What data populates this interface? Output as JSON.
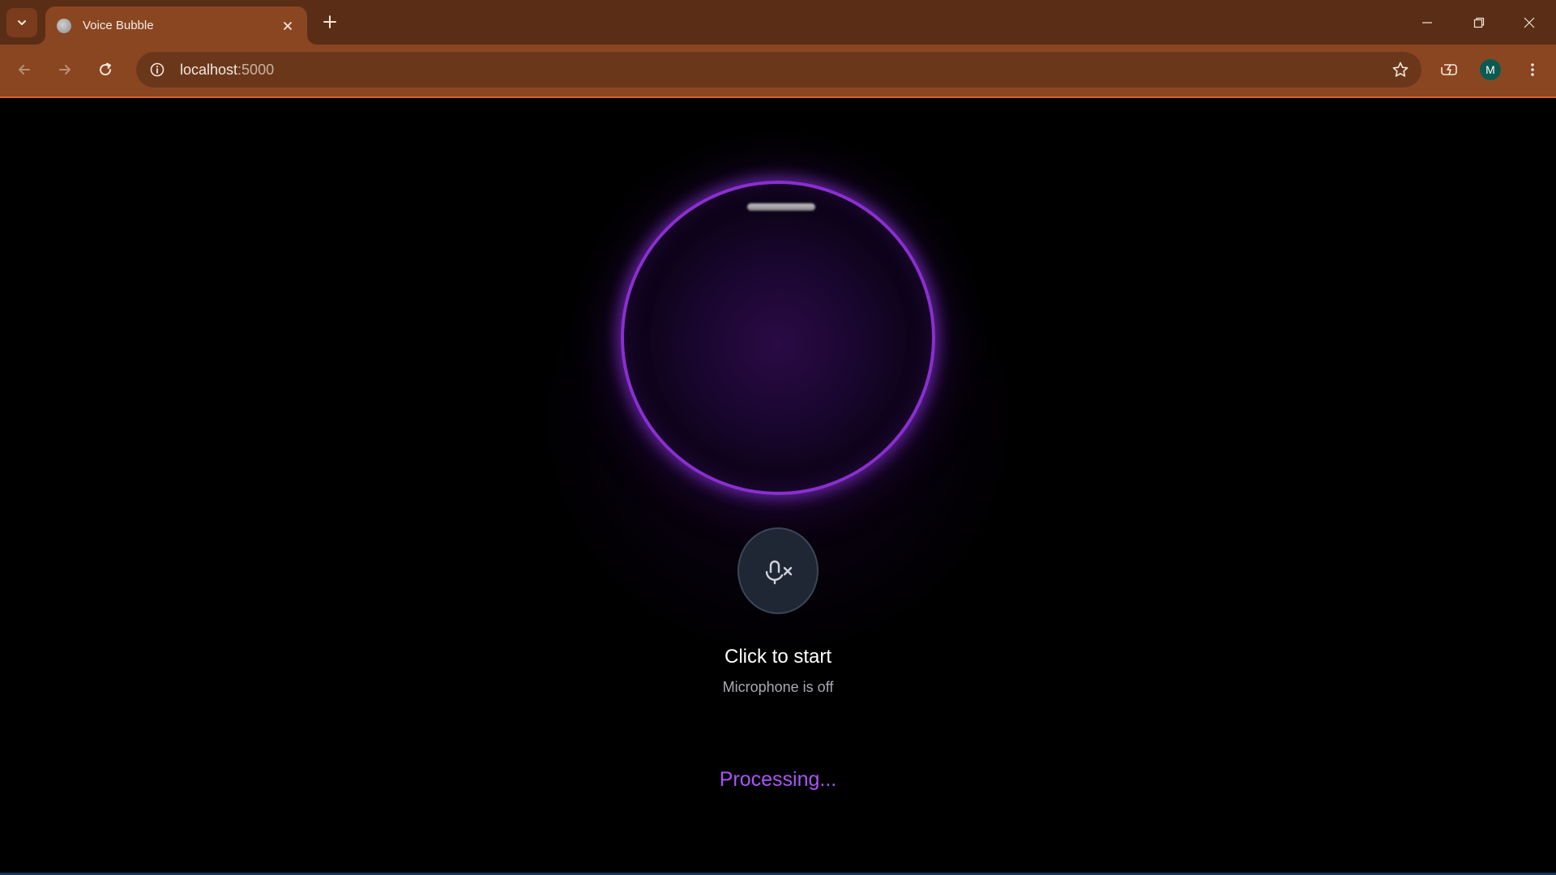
{
  "browser": {
    "tab_title": "Voice Bubble",
    "url_host": "localhost",
    "url_port": ":5000",
    "profile_initial": "M",
    "accent_color": "#8a4621"
  },
  "app": {
    "status_title": "Click to start",
    "status_subtitle": "Microphone is off",
    "processing_text": "Processing...",
    "bubble_ring_color": "#8a2fd0",
    "processing_color": "#a855f7",
    "mic_icon": "mic-off-icon"
  }
}
